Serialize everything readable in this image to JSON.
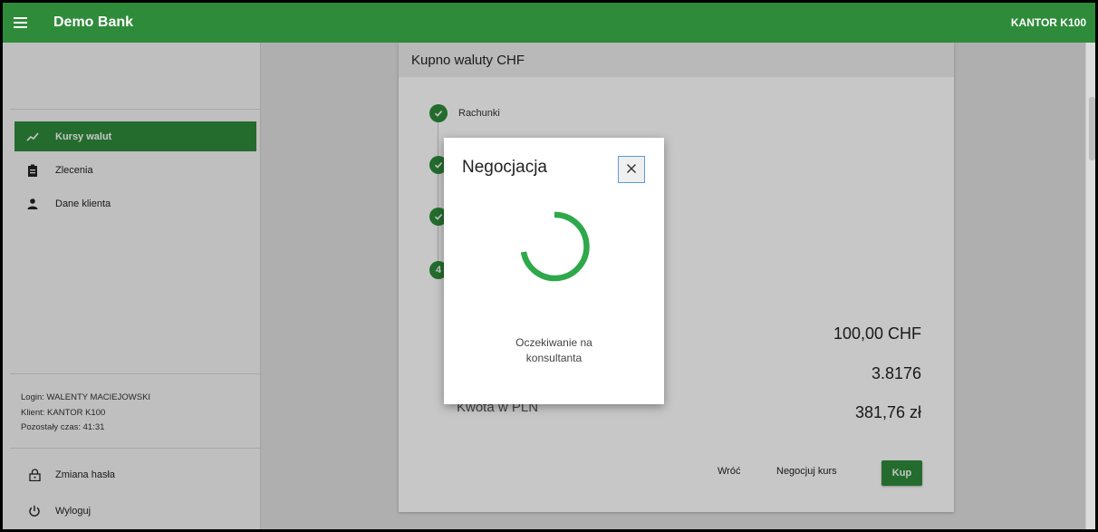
{
  "header": {
    "title": "Demo Bank",
    "brand": "KANTOR K100"
  },
  "sidebar": {
    "items": [
      {
        "label": "Kursy walut",
        "icon": "trend-icon",
        "active": true
      },
      {
        "label": "Zlecenia",
        "icon": "clipboard-icon",
        "active": false
      },
      {
        "label": "Dane klienta",
        "icon": "person-icon",
        "active": false
      }
    ],
    "login": "Login: WALENTY MACIEJOWSKI",
    "client": "Klient: KANTOR K100",
    "time_left": "Pozostały czas: 41:31",
    "change_password": "Zmiana hasła",
    "logout": "Wyloguj"
  },
  "card": {
    "title": "Kupno waluty CHF",
    "steps": [
      {
        "label": "Rachunki",
        "state": "done"
      },
      {
        "label": "",
        "state": "done"
      },
      {
        "label": "",
        "state": "done"
      },
      {
        "label": "4",
        "state": "current"
      }
    ],
    "amount_chf": "100,00 CHF",
    "rate": "3.8176",
    "pln_label": "Kwota w PLN",
    "amount_pln": "381,76 zł",
    "back_label": "Wróć",
    "negotiate_label": "Negocjuj kurs",
    "buy_label": "Kup"
  },
  "modal": {
    "title": "Negocjacja",
    "message": "Oczekiwanie na konsultanta",
    "close_label": "×"
  },
  "colors": {
    "primary": "#2e8b3a",
    "spinner": "#2ea84a"
  }
}
